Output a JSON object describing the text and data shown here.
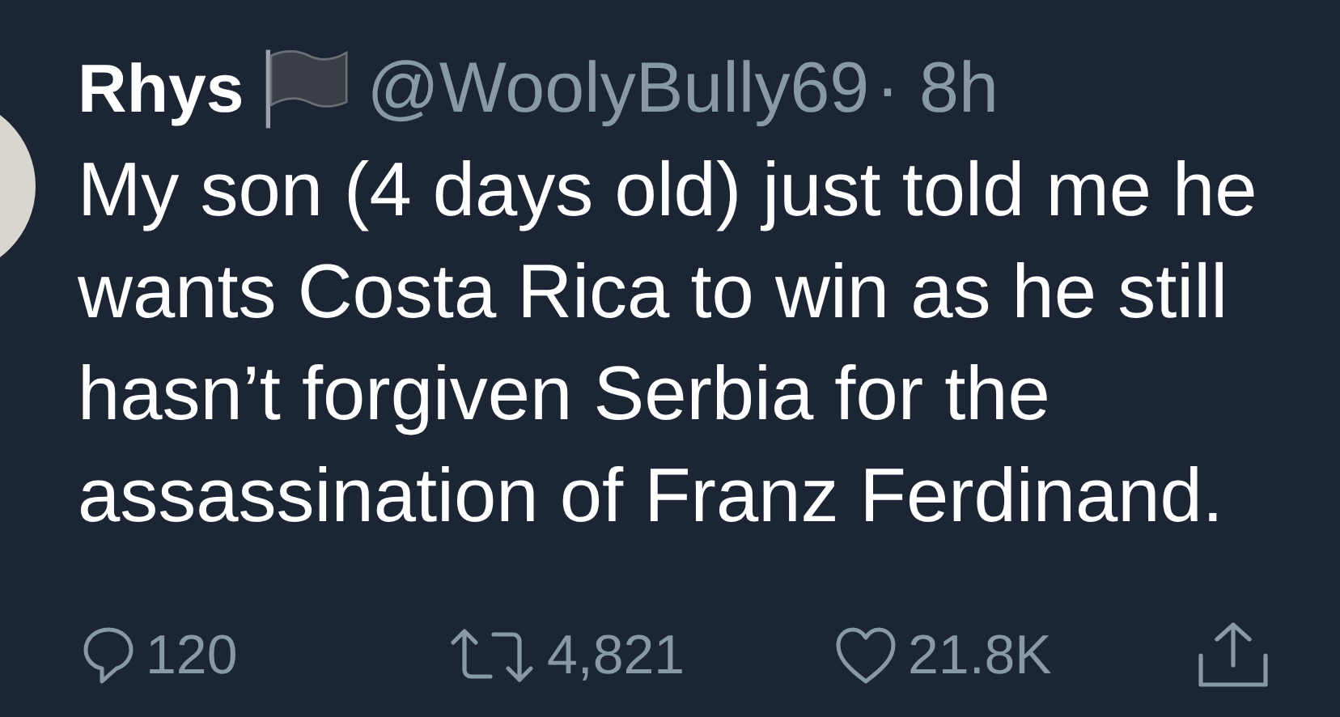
{
  "tweet": {
    "name": "Rhys",
    "handle": "@WoolyBully69",
    "time": "· 8h",
    "text": "My son (4 days old) just told me he wants Costa Rica to win as he still hasn’t forgiven Serbia for the assassination of Franz Ferdinand.",
    "actions": [
      {
        "kind": "reply",
        "count": "120"
      },
      {
        "kind": "retweet",
        "count": "4,821"
      },
      {
        "kind": "like",
        "count": "21.8K"
      },
      {
        "kind": "share"
      }
    ]
  }
}
